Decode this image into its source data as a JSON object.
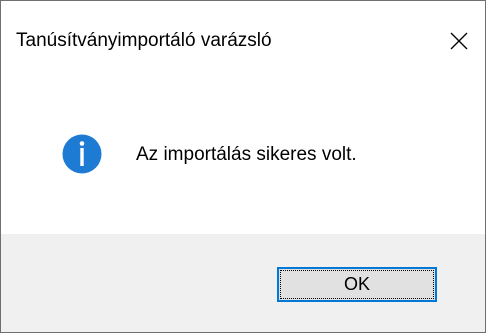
{
  "window": {
    "title": "Tanúsítványimportáló varázsló",
    "close_icon": "close-icon"
  },
  "message": {
    "icon": "info-icon",
    "text": "Az importálás sikeres volt."
  },
  "buttons": {
    "ok_label": "OK"
  },
  "colors": {
    "info_blue": "#1e7bd4",
    "accent_border": "#0078d7",
    "footer_bg": "#f0f0f0",
    "button_bg": "#e1e1e1"
  }
}
